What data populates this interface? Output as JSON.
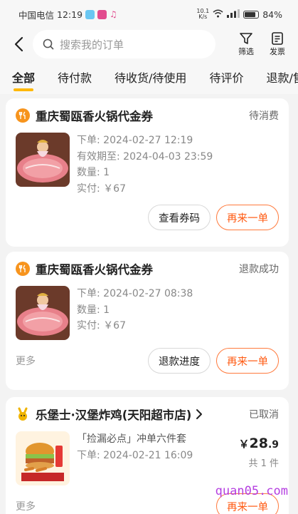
{
  "status_bar": {
    "carrier": "中国电信",
    "time": "12:19",
    "net_speed_value": "10.1",
    "net_speed_unit": "K/s",
    "battery": "84%"
  },
  "header": {
    "search_placeholder": "搜索我的订单",
    "filter_label": "筛选",
    "invoice_label": "发票"
  },
  "tabs": [
    "全部",
    "待付款",
    "待收货/待使用",
    "待评价",
    "退款/售后"
  ],
  "orders": [
    {
      "store": "重庆蜀瓯香火锅代金券",
      "status": "待消费",
      "lines": [
        "下单: 2024-02-27 12:19",
        "有效期至: 2024-04-03 23:59",
        "数量: 1",
        "实付: ￥67"
      ],
      "btn1": "查看券码",
      "btn2": "再来一单"
    },
    {
      "store": "重庆蜀瓯香火锅代金券",
      "status": "退款成功",
      "lines": [
        "下单: 2024-02-27 08:38",
        "数量: 1",
        "实付: ￥67"
      ],
      "more": "更多",
      "btn1": "退款进度",
      "btn2": "再来一单"
    },
    {
      "store": "乐堡士·汉堡炸鸡(天阳超市店)",
      "status": "已取消",
      "lines": [
        "「捡漏必点」冲单六件套",
        "下单: 2024-02-21 16:09"
      ],
      "price_symbol": "￥",
      "price_int": "28",
      "price_dec": ".9",
      "count": "共 1 件",
      "more": "更多",
      "btn2": "再来一单"
    }
  ],
  "watermark": "quan05.com",
  "colors": {
    "accent": "#ff5a12",
    "tab_indicator": "#ffb800",
    "store_icon": "#f7941d"
  }
}
